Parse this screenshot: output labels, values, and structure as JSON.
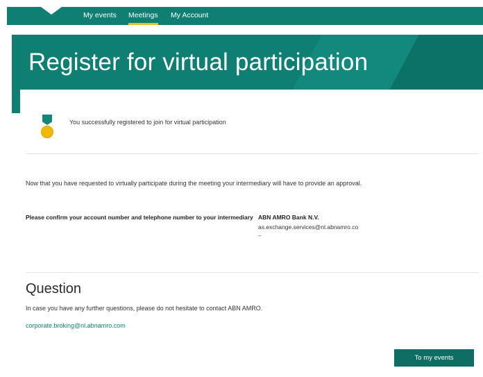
{
  "nav": {
    "items": [
      {
        "label": "My events"
      },
      {
        "label": "Meetings",
        "active": true
      },
      {
        "label": "My Account"
      }
    ]
  },
  "banner": {
    "title": "Register for virtual participation"
  },
  "success": {
    "icon": "medal-icon",
    "message": "You successfully registered to join for virtual participation"
  },
  "intro": "Now that you have requested to virtually participate during the meeting your intermediary will have to provide an approval.",
  "confirm": {
    "label": "Please confirm your account number and telephone number to your intermediary",
    "bank_name": "ABN AMRO Bank N.V.",
    "bank_email": "as.exchange.services@nl.abnamro.co",
    "bank_phone": "–"
  },
  "question": {
    "title": "Question",
    "text": "In case you have any further questions, please do not hesitate to contact ABN AMRO.",
    "link": "corporate.broking@nl.abnamro.com"
  },
  "actions": {
    "events_button": "To my events"
  },
  "colors": {
    "brand_green": "#0f7f74",
    "accent_yellow": "#f0c020"
  }
}
